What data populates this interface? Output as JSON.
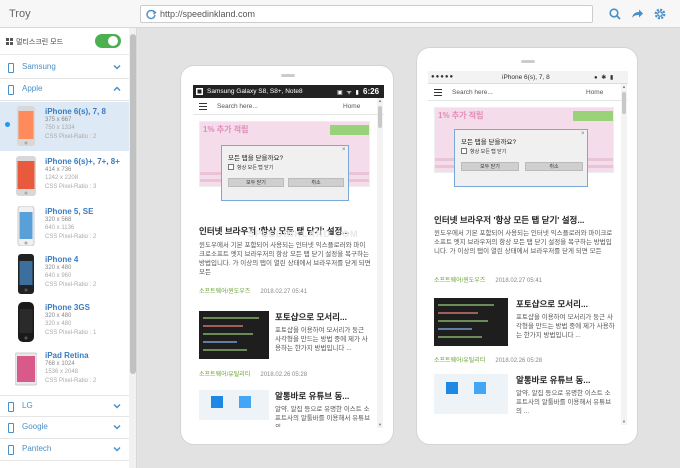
{
  "app": {
    "title": "Troy"
  },
  "address_bar": {
    "url": "http://speedinkland.com"
  },
  "toolbar": {
    "search_icon": "search-icon",
    "share_icon": "share-icon",
    "settings_icon": "gear-icon"
  },
  "sidebar": {
    "multiscreen_label": "멀티스크린 모드",
    "multiscreen_on": true,
    "brands_top": [
      {
        "label": "Samsung"
      },
      {
        "label": "Apple"
      }
    ],
    "devices": [
      {
        "name": "iPhone 6(s), 7, 8",
        "size": "375 x 667",
        "res": "750 x 1334",
        "ratio": "CSS Pixel-Ratio : 2",
        "selected": true
      },
      {
        "name": "iPhone 6(s)+, 7+, 8+",
        "size": "414 x 736",
        "res": "1242 x 2208",
        "ratio": "CSS Pixel-Ratio : 3",
        "selected": false
      },
      {
        "name": "iPhone 5, SE",
        "size": "320 x 568",
        "res": "640 x 1136",
        "ratio": "CSS Pixel-Ratio : 2",
        "selected": false
      },
      {
        "name": "iPhone 4",
        "size": "320 x 480",
        "res": "640 x 960",
        "ratio": "CSS Pixel-Ratio : 2",
        "selected": false
      },
      {
        "name": "iPhone 3GS",
        "size": "320 x 480",
        "res": "320 x 480",
        "ratio": "CSS Pixel-Ratio : 1",
        "selected": false
      },
      {
        "name": "iPad Retina",
        "size": "768 x 1024",
        "res": "1536 x 2048",
        "ratio": "CSS Pixel-Ratio : 2",
        "selected": false
      }
    ],
    "brands_bottom": [
      {
        "label": "LG"
      },
      {
        "label": "Google"
      },
      {
        "label": "Pantech"
      }
    ]
  },
  "devices_view": {
    "left": {
      "status_title": "Samsung Galaxy S8, S8+, Note8",
      "status_icons": "▣ ᯤ ▮",
      "time": "6:26"
    },
    "right": {
      "status_title": "iPhone 6(s), 7, 8",
      "status_icons": "● ✱ ▮"
    },
    "site": {
      "search_placeholder": "Search here...",
      "home": "Home",
      "hero_tag": "1% 추가 적립",
      "dialog_title": "모든 탭을 닫을까요?",
      "dialog_check": "항상 모든 탭 닫기",
      "dialog_ok": "모두 닫기",
      "dialog_cancel": "취소",
      "article_title": "인터넷 브라우저 '항상 모든 탭 닫기' 설정...",
      "article_body": "윈도우에서 기본 포함되어 사용되는 인터넷 익스플로러와 마이크로소프트 엣지 브라우저의 항상 모든 탭 닫기 설정을 복구하는 방법입니다. 가 이상의 탭이 열린 상태에서 브라우저를 닫게 되면 모든",
      "article_cat": "소프트웨어/윈도우즈",
      "article_date": "2018.02.27 05:41",
      "card1_title": "포토샵으로 모서리...",
      "card1_body": "포토샵을 이용하여 모서리가 둥근 사각형을 만드는 방법 중에 제가 사용하는 한가지 방법입니다 ...",
      "card1_cat": "소프트웨어/유틸리티",
      "card1_date": "2018.02.26 05:28",
      "card2_title": "알통바로 유튜브 동...",
      "card2_body": "알약, 알집 등으로 유명한 이스트 소프트사의 알툴바를 이용해서 유튜브의 ...",
      "watermark": "SPEEDINKLAND.COM"
    }
  },
  "colors": {
    "accent": "#4a90c8",
    "toggle_on": "#4caf50",
    "category_green": "#6aa230"
  }
}
